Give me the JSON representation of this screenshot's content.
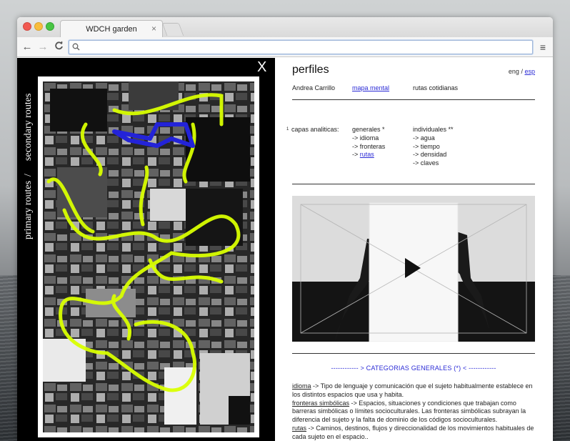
{
  "browser": {
    "tab_title": "WDCH garden",
    "tab_close": "×",
    "url": "",
    "back": "←",
    "forward": "→",
    "reload": "C",
    "menu": "≡"
  },
  "map_panel": {
    "close": "X",
    "legend_primary": "primary routes",
    "legend_separator": "/",
    "legend_secondary": "secondary routes",
    "colors": {
      "primary": "#2323d8",
      "secondary": "#d9ff00"
    }
  },
  "content": {
    "title": "perfiles",
    "lang_eng": "eng",
    "lang_sep": "/",
    "lang_esp": "esp",
    "subnav": {
      "name": "Andrea Carrillo",
      "link": "mapa mental",
      "routes": "rutas cotidianas"
    },
    "caps": {
      "num": "1",
      "label": "capas analiticas:",
      "general_title": "generales *",
      "general_items": [
        "-> idioma",
        "-> fronteras"
      ],
      "general_link_prefix": "-> ",
      "general_link": "rutas",
      "individual_title": "individuales **",
      "individual_items": [
        "-> agua",
        "-> tiempo",
        "-> densidad",
        "-> claves"
      ]
    },
    "video": {
      "play": "play-icon"
    },
    "categories_heading": "------------ > CATEGORIAS GENERALES (*) < ------------",
    "definitions": [
      {
        "term": "idioma",
        "text": " -> Tipo de lenguaje y comunicación que el sujeto habitualmente establece en los distintos espacios que usa y habita."
      },
      {
        "term": "fronteras simbólicas",
        "text": " -> Espacios, situaciones y condiciones que trabajan como barreras simbólicas o límites socioculturales. Las fronteras simbólicas subrayan la diferencia del sujeto y la falta de dominio de los códigos socioculturales."
      },
      {
        "term": "rutas",
        "text": " -> Caminos, destinos, flujos y direccionalidad  de los movimientos habituales de cada sujeto en el espacio.."
      }
    ]
  }
}
